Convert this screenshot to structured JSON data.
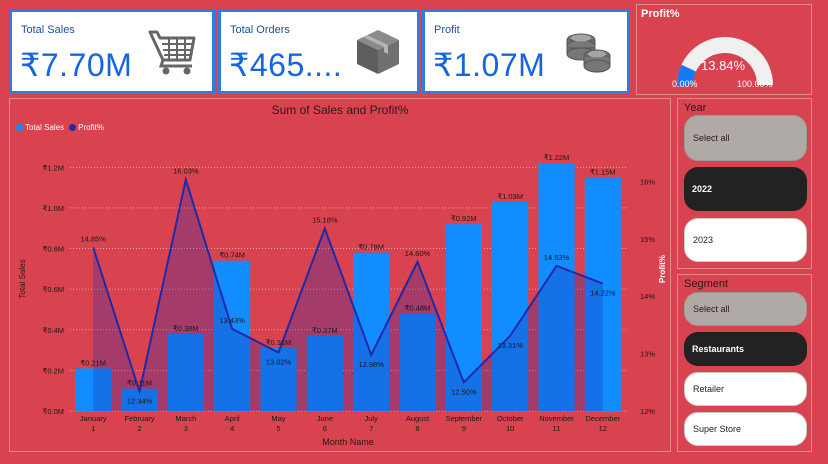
{
  "kpis": {
    "sales": {
      "label": "Total Sales",
      "value": "₹7.70M",
      "icon": "shopping-cart-icon"
    },
    "orders": {
      "label": "Total Orders",
      "value": "₹465....",
      "icon": "package-box-icon"
    },
    "profit": {
      "label": "Profit",
      "value": "₹1.07M",
      "icon": "coin-stack-icon"
    }
  },
  "gauge": {
    "title": "Profit%",
    "value": 13.84,
    "min": 0,
    "max": 100,
    "value_label": "13.84%",
    "min_label": "0.00%",
    "max_label": "100.00%",
    "colors": {
      "fill": "#1877f2",
      "track": "#f0f0f0"
    }
  },
  "chart_data": {
    "type": "bar",
    "title": "Sum of Sales and Profit%",
    "xlabel": "Month Name",
    "ylabel": "Total Sales",
    "y2label": "Profit%",
    "legend": "top-left",
    "grid": true,
    "categories": [
      "January\n1",
      "February\n2",
      "March\n3",
      "April\n4",
      "May\n5",
      "June\n6",
      "July\n7",
      "August\n8",
      "September\n9",
      "October\n10",
      "November\n11",
      "December\n12"
    ],
    "ylim": [
      0,
      1.3
    ],
    "y_ticks": [
      "₹0.0M",
      "₹0.2M",
      "₹0.4M",
      "₹0.6M",
      "₹0.8M",
      "₹1.0M",
      "₹1.2M"
    ],
    "y2lim": [
      12,
      16.6
    ],
    "y2_ticks": [
      "12%",
      "13%",
      "14%",
      "15%",
      "16%"
    ],
    "series": [
      {
        "name": "Total Sales",
        "kind": "bar",
        "color": "#118dff",
        "values": [
          0.21,
          0.11,
          0.38,
          0.74,
          0.31,
          0.37,
          0.78,
          0.48,
          0.92,
          1.03,
          1.22,
          1.15
        ],
        "labels": [
          "₹0.21M",
          "₹0.11M",
          "₹0.38M",
          "₹0.74M",
          "₹0.31M",
          "₹0.37M",
          "₹0.78M",
          "₹0.48M",
          "₹0.92M",
          "₹1.03M",
          "₹1.22M",
          "₹1.15M"
        ]
      },
      {
        "name": "Profit%",
        "kind": "line",
        "color": "#1e2aa8",
        "values": [
          14.85,
          12.34,
          16.03,
          13.43,
          13.02,
          15.18,
          12.98,
          14.6,
          12.5,
          13.31,
          14.53,
          14.22
        ],
        "labels": [
          "14.85%",
          "12.34%",
          "16.03%",
          "13.43%",
          "13.02%",
          "15.18%",
          "12.98%",
          "14.60%",
          "12.50%",
          "13.31%",
          "14.53%",
          "14.22%"
        ]
      }
    ]
  },
  "slicers": {
    "year": {
      "title": "Year",
      "options": [
        "Select all",
        "2022",
        "2023"
      ]
    },
    "segment": {
      "title": "Segment",
      "options": [
        "Select all",
        "Restaurants",
        "Retailer",
        "Super Store"
      ]
    }
  }
}
